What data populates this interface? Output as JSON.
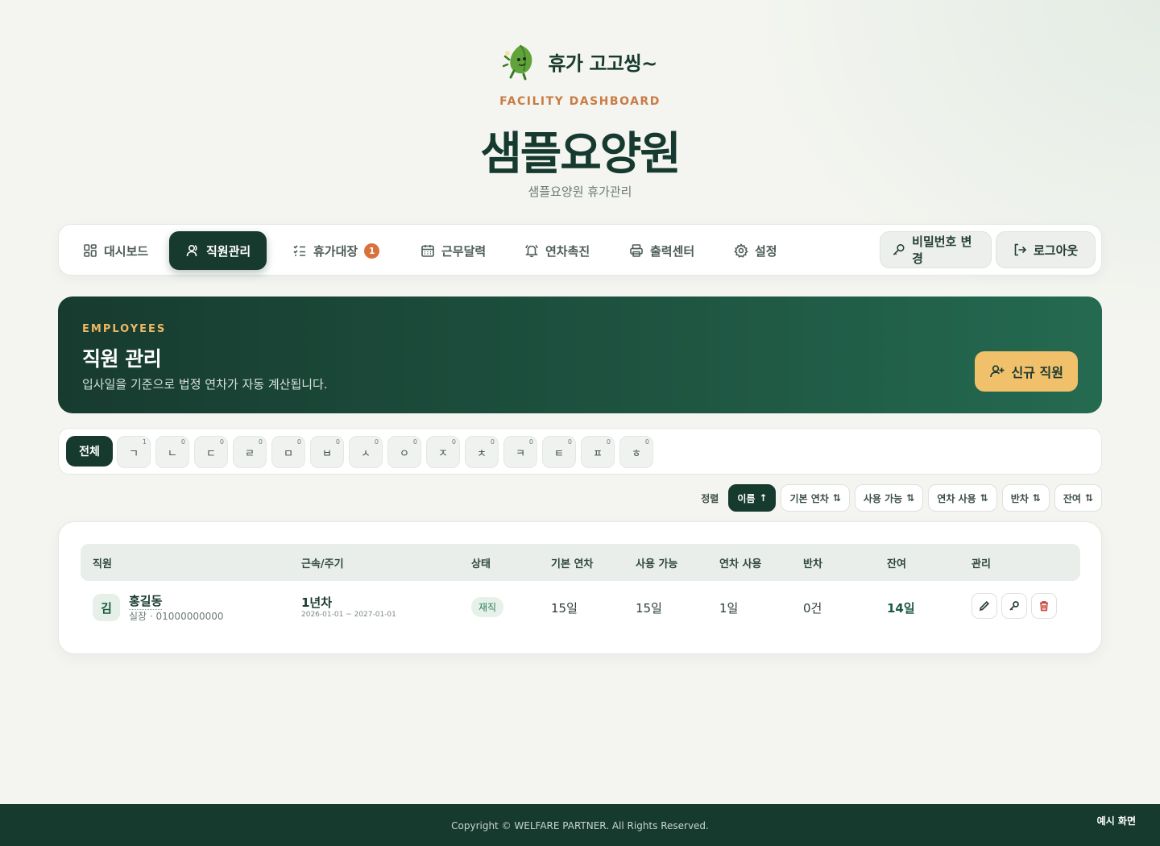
{
  "brand": {
    "name": "휴가 고고씽~"
  },
  "facility": {
    "eyebrow": "FACILITY DASHBOARD",
    "title": "샘플요양원",
    "subtitle": "샘플요양원 휴가관리"
  },
  "nav": {
    "items": [
      {
        "label": "대시보드",
        "icon": "grid-icon"
      },
      {
        "label": "직원관리",
        "icon": "users-icon",
        "active": true
      },
      {
        "label": "휴가대장",
        "icon": "checklist-icon",
        "badge": "1"
      },
      {
        "label": "근무달력",
        "icon": "calendar-icon"
      },
      {
        "label": "연차촉진",
        "icon": "bell-icon"
      },
      {
        "label": "출력센터",
        "icon": "printer-icon"
      },
      {
        "label": "설정",
        "icon": "gear-icon"
      }
    ],
    "password_label": "비밀번호 변경",
    "logout_label": "로그아웃"
  },
  "hero": {
    "eyebrow": "EMPLOYEES",
    "title": "직원 관리",
    "description": "입사일을 기준으로 법정 연차가 자동 계산됩니다.",
    "new_button": "신규 직원"
  },
  "char_filter": {
    "all_label": "전체",
    "chars": [
      {
        "char": "ㄱ",
        "count": "1"
      },
      {
        "char": "ㄴ",
        "count": "0"
      },
      {
        "char": "ㄷ",
        "count": "0"
      },
      {
        "char": "ㄹ",
        "count": "0"
      },
      {
        "char": "ㅁ",
        "count": "0"
      },
      {
        "char": "ㅂ",
        "count": "0"
      },
      {
        "char": "ㅅ",
        "count": "0"
      },
      {
        "char": "ㅇ",
        "count": "0"
      },
      {
        "char": "ㅈ",
        "count": "0"
      },
      {
        "char": "ㅊ",
        "count": "0"
      },
      {
        "char": "ㅋ",
        "count": "0"
      },
      {
        "char": "ㅌ",
        "count": "0"
      },
      {
        "char": "ㅍ",
        "count": "0"
      },
      {
        "char": "ㅎ",
        "count": "0"
      }
    ]
  },
  "sort": {
    "label": "정렬",
    "options": [
      {
        "label": "이름",
        "arrow": "↑",
        "active": true
      },
      {
        "label": "기본 연차",
        "arrow": "⇅"
      },
      {
        "label": "사용 가능",
        "arrow": "⇅"
      },
      {
        "label": "연차 사용",
        "arrow": "⇅"
      },
      {
        "label": "반차",
        "arrow": "⇅"
      },
      {
        "label": "잔여",
        "arrow": "⇅"
      }
    ]
  },
  "table": {
    "headers": [
      "직원",
      "근속/주기",
      "상태",
      "기본 연차",
      "사용 가능",
      "연차 사용",
      "반차",
      "잔여",
      "관리"
    ],
    "rows": [
      {
        "initial": "김",
        "name": "홍길동",
        "sub": "실장 · 01000000000",
        "tenure": "1년차",
        "period": "2026-01-01 ~ 2027-01-01",
        "status": "재직",
        "base": "15일",
        "available": "15일",
        "used": "1일",
        "half": "0건",
        "remain": "14일"
      }
    ]
  },
  "footer": {
    "copyright": "Copyright © WELFARE PARTNER. All Rights Reserved.",
    "example": "예시 화면"
  },
  "colors": {
    "primary": "#173a2f",
    "accent": "#f0c06b",
    "eyebrow": "#c97c44",
    "badge": "#d9713e",
    "danger": "#c84a3c"
  }
}
